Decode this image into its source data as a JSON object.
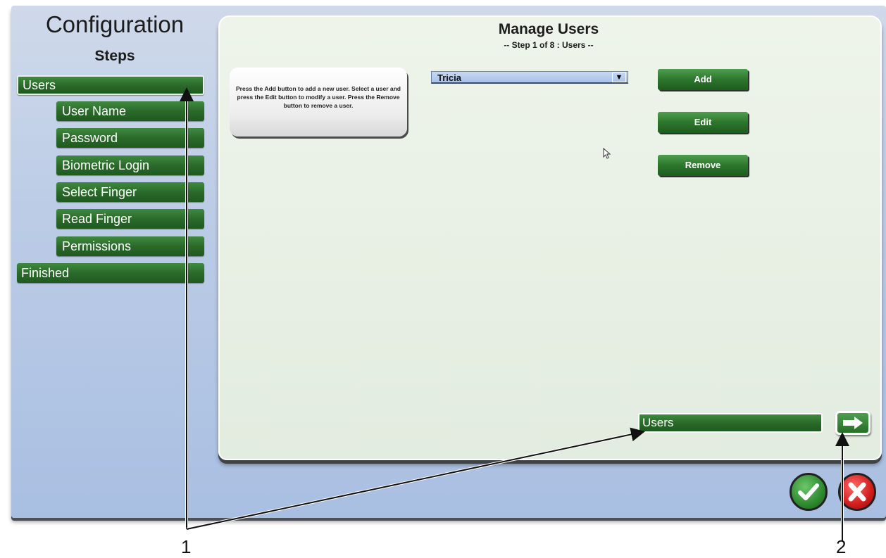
{
  "sidebar": {
    "title": "Configuration",
    "subtitle": "Steps",
    "steps": [
      {
        "label": "Users"
      },
      {
        "label": "User Name"
      },
      {
        "label": "Password"
      },
      {
        "label": "Biometric Login"
      },
      {
        "label": "Select Finger"
      },
      {
        "label": "Read Finger"
      },
      {
        "label": "Permissions"
      },
      {
        "label": "Finished"
      }
    ]
  },
  "panel": {
    "title": "Manage Users",
    "subtitle": "-- Step 1 of 8 : Users --",
    "help_text": "Press the Add button to add a new user. Select a user and press the Edit button to modify a user.  Press the Remove button to remove a user.",
    "user_select": {
      "value": "Tricia"
    },
    "buttons": {
      "add": "Add",
      "edit": "Edit",
      "remove": "Remove"
    },
    "current_step": "Users"
  },
  "callouts": {
    "one": "1",
    "two": "2"
  },
  "colors": {
    "accent_green": "#2b6a2b",
    "frame_blue": "#bccce6",
    "panel_bg": "#e3ece0",
    "cancel_red": "#d11c1c"
  },
  "icons": {
    "dropdown": "chevron-down-icon",
    "next": "arrow-right-icon",
    "ok": "check-icon",
    "cancel": "close-icon",
    "cursor": "mouse-pointer-icon"
  }
}
